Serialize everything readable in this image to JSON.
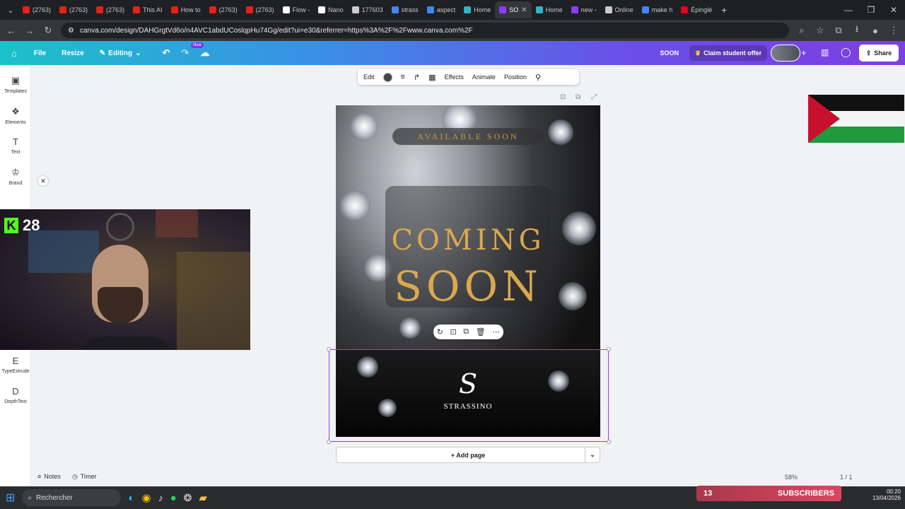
{
  "browser": {
    "tabs": [
      {
        "title": "(2763)",
        "color": "#e62117",
        "active": false
      },
      {
        "title": "(2763)",
        "color": "#e62117",
        "active": false
      },
      {
        "title": "(2763)",
        "color": "#e62117",
        "active": false
      },
      {
        "title": "This AI",
        "color": "#e62117",
        "active": false
      },
      {
        "title": "How to",
        "color": "#e62117",
        "active": false
      },
      {
        "title": "(2763)",
        "color": "#e62117",
        "active": false
      },
      {
        "title": "(2763)",
        "color": "#e62117",
        "active": false
      },
      {
        "title": "Flow -",
        "color": "#ffffff",
        "active": false
      },
      {
        "title": "Nano",
        "color": "#ffffff",
        "active": false
      },
      {
        "title": "177603",
        "color": "#cccccc",
        "active": false
      },
      {
        "title": "strass",
        "color": "#4285f4",
        "active": false
      },
      {
        "title": "aspect",
        "color": "#4285f4",
        "active": false
      },
      {
        "title": "Home",
        "color": "#2bb7c4",
        "active": false
      },
      {
        "title": "SO",
        "color": "#8b3dff",
        "active": true
      },
      {
        "title": "Home",
        "color": "#2bb7c4",
        "active": false
      },
      {
        "title": "new -",
        "color": "#8b3dff",
        "active": false
      },
      {
        "title": "Online",
        "color": "#cccccc",
        "active": false
      },
      {
        "title": "make h",
        "color": "#4285f4",
        "active": false
      },
      {
        "title": "Épinglé",
        "color": "#e60023",
        "active": false
      }
    ],
    "url": "canva.com/design/DAHGrgtVd6o/n4AVC1abdUCoslqpHu74Gg/edit?ui=e30&referrer=https%3A%2F%2Fwww.canva.com%2F"
  },
  "header": {
    "file": "File",
    "resize": "Resize",
    "editing": "Editing",
    "new_badge": "New",
    "doc_title": "SOON",
    "claim": "Claim student offer",
    "share": "Share"
  },
  "sidebar": {
    "items": [
      {
        "label": "Templates",
        "icon": "templates-icon"
      },
      {
        "label": "Elements",
        "icon": "elements-icon"
      },
      {
        "label": "Text",
        "icon": "text-icon"
      },
      {
        "label": "Brand",
        "icon": "brand-icon"
      },
      {
        "label": "TypeExtrude",
        "icon": "typeextrude-icon"
      },
      {
        "label": "DepthText",
        "icon": "depthtext-icon"
      }
    ]
  },
  "toolbar": {
    "edit": "Edit",
    "effects": "Effects",
    "animate": "Animate",
    "position": "Position"
  },
  "design": {
    "available": "AVAILABLE SOON",
    "coming": "COMING",
    "soon": "SOON",
    "logo_letter": "S",
    "brand": "STRASSINO"
  },
  "canvas": {
    "add_page": "+ Add page"
  },
  "footer": {
    "notes": "Notes",
    "timer": "Timer",
    "zoom": "58%",
    "pages": "1 / 1"
  },
  "webcam": {
    "count": "28"
  },
  "overlay": {
    "subs_count": "13",
    "subs_label": "SUBSCRIBERS",
    "clock": "00:20",
    "date": "13/04/2026"
  },
  "taskbar": {
    "search": "Rechercher"
  },
  "colors": {
    "accent": "#8b3dff",
    "gold": "#d9a94f",
    "kick_green": "#53fc18"
  }
}
